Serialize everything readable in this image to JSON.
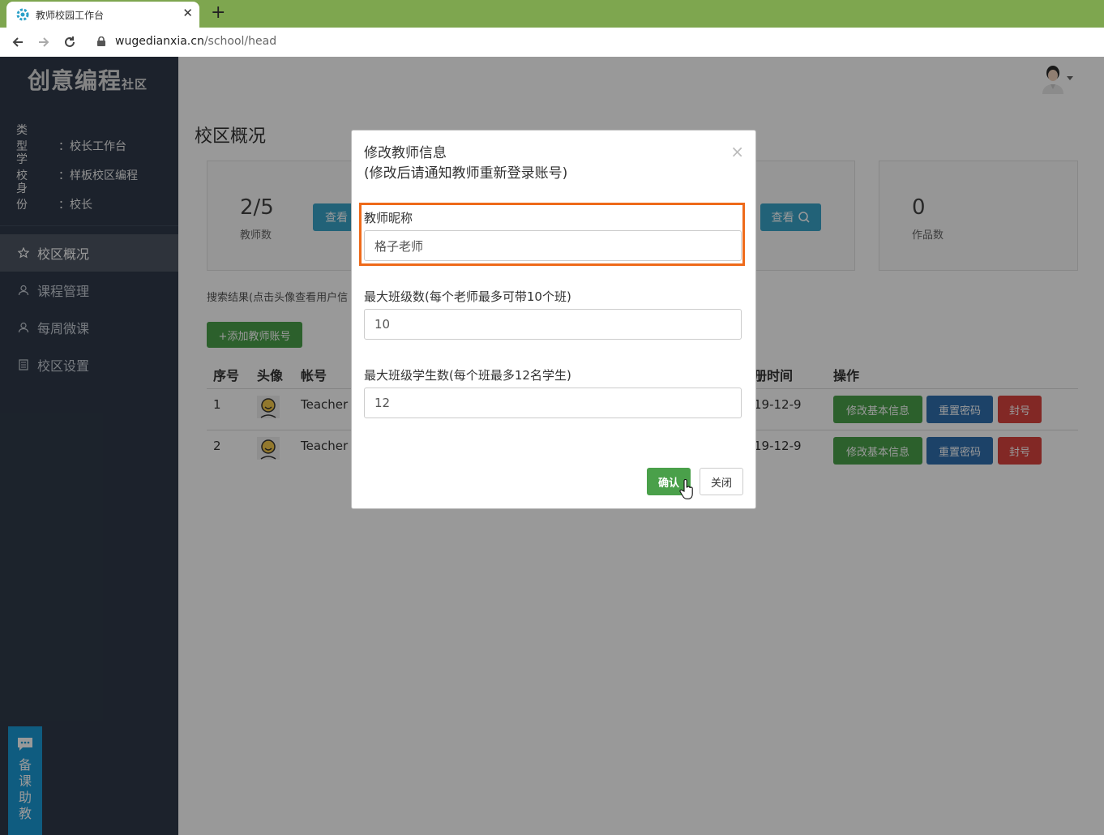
{
  "browser": {
    "tab_title": "教师校园工作台",
    "url_domain": "wugedianxia.cn",
    "url_path": "/school/head",
    "chrome_color": "#7ea64f"
  },
  "sidebar": {
    "logo_main": "创意编程",
    "logo_sub": "社区",
    "info": [
      {
        "key": "类型",
        "value": "：校长工作台"
      },
      {
        "key": "学校",
        "value": "：样板校区编程"
      },
      {
        "key": "身份",
        "value": "：校长"
      }
    ],
    "menu": [
      {
        "label": "校区概况",
        "icon": "star-icon",
        "active": true
      },
      {
        "label": "课程管理",
        "icon": "user-icon",
        "active": false
      },
      {
        "label": "每周微课",
        "icon": "user-icon",
        "active": false
      },
      {
        "label": "校区设置",
        "icon": "document-icon",
        "active": false
      }
    ],
    "chat_widget": "备课助教"
  },
  "main": {
    "title": "校区概况",
    "stats": [
      {
        "value": "2/5",
        "label": "教师数",
        "button": "查看"
      },
      {
        "value": "0",
        "label": "作品数"
      }
    ],
    "mid_view_button": "查看",
    "search_label": "搜索结果(点击头像查看用户信",
    "add_button": "+添加教师账号",
    "table": {
      "headers": [
        "序号",
        "头像",
        "帐号",
        "册时间",
        "操作"
      ],
      "rows": [
        {
          "index": "1",
          "account": "Teacher",
          "time": "19-12-9"
        },
        {
          "index": "2",
          "account": "Teacher",
          "time": "19-12-9"
        }
      ],
      "actions": {
        "edit": "修改基本信息",
        "reset": "重置密码",
        "ban": "封号"
      }
    }
  },
  "modal": {
    "title_line1": "修改教师信息",
    "title_line2": "(修改后请通知教师重新登录账号)",
    "close_symbol": "×",
    "fields": [
      {
        "label": "教师昵称",
        "value": "格子老师"
      },
      {
        "label": "最大班级数(每个老师最多可带10个班)",
        "value": "10"
      },
      {
        "label": "最大班级学生数(每个班最多12名学生)",
        "value": "12"
      }
    ],
    "confirm_label": "确认",
    "close_label": "关闭",
    "highlight_color": "#ee6a1a"
  }
}
